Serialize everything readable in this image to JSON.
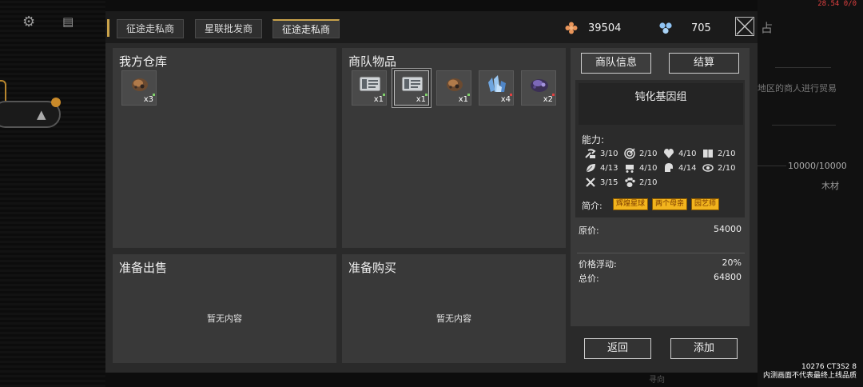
{
  "debug": {
    "fps": "28.54 0/0",
    "build": "10276 CT3S2 8",
    "notice": "内测画面不代表最终上线品质"
  },
  "background": {
    "right_text_1": "地区的商人进行贸易",
    "right_value": "10000/10000",
    "right_item": "木材",
    "right_partial": "占",
    "bottom_partial": "寻向"
  },
  "tabs": [
    {
      "label": "征途走私商"
    },
    {
      "label": "星联批发商"
    },
    {
      "label": "征途走私商"
    }
  ],
  "currency": {
    "gold": {
      "icon": "orange-gem-icon",
      "value": "39504",
      "color": "#e9955a"
    },
    "crystal": {
      "icon": "blue-crystal-icon",
      "value": "705",
      "color": "#8fc3f3"
    }
  },
  "my_storage": {
    "title": "我方仓库",
    "items": [
      {
        "icon": "ore-chunk-icon",
        "qty": "x3"
      }
    ]
  },
  "caravan": {
    "title": "商队物品",
    "items": [
      {
        "icon": "gene-chip-icon",
        "qty": "x1",
        "mark": "#7fd06a"
      },
      {
        "icon": "gene-chip-icon",
        "qty": "x1",
        "mark": "#7fd06a"
      },
      {
        "icon": "ore-chunk-icon",
        "qty": "x1",
        "mark": "#7fd06a"
      },
      {
        "icon": "blue-crystal-cluster-icon",
        "qty": "x4",
        "mark": "#e04040"
      },
      {
        "icon": "purple-ore-icon",
        "qty": "x2",
        "mark": "#e04040"
      }
    ]
  },
  "sell": {
    "title": "准备出售",
    "empty": "暂无内容"
  },
  "buy": {
    "title": "准备购买",
    "empty": "暂无内容"
  },
  "info": {
    "tab_info": "商队信息",
    "tab_settle": "结算",
    "item_name": "钝化基因组",
    "ability_label": "能力:",
    "stats": [
      {
        "icon": "mining-icon",
        "value": "3/10"
      },
      {
        "icon": "target-icon",
        "value": "2/10"
      },
      {
        "icon": "heart-icon",
        "value": "4/10"
      },
      {
        "icon": "book-icon",
        "value": "2/10"
      },
      {
        "icon": "leaf-icon",
        "value": "4/13"
      },
      {
        "icon": "cart-icon",
        "value": "4/10"
      },
      {
        "icon": "helmet-icon",
        "value": "4/14"
      },
      {
        "icon": "eye-icon",
        "value": "2/10"
      },
      {
        "icon": "tools-icon",
        "value": "3/15"
      },
      {
        "icon": "paw-icon",
        "value": "2/10"
      }
    ],
    "intro_label": "简介:",
    "tags": [
      "辉煌星球",
      "两个母亲",
      "园艺师"
    ],
    "original_price_label": "原价:",
    "original_price": "54000",
    "fluctuation_label": "价格浮动:",
    "fluctuation": "20%",
    "total_label": "总价:",
    "total": "64800"
  },
  "actions": {
    "back": "返回",
    "add": "添加"
  }
}
